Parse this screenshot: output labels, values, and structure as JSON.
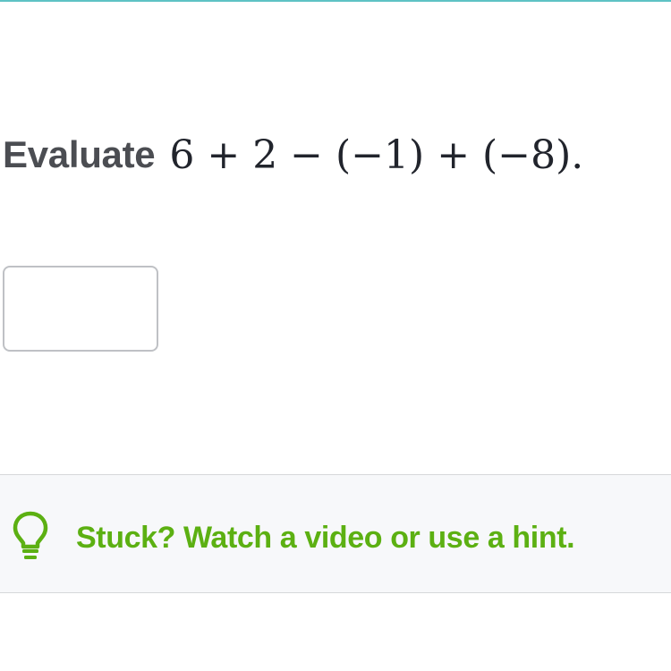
{
  "question": {
    "prompt_word": "Evaluate",
    "expression": "6 + 2 − (−1) + (−8)."
  },
  "answer": {
    "value": ""
  },
  "hint": {
    "icon": "lightbulb-icon",
    "text": "Stuck? Watch a video or use a hint."
  },
  "colors": {
    "accent_teal": "#5ec2c4",
    "hint_green": "#5cb012",
    "text_dark": "#21242c",
    "text_gray": "#4b4d52"
  }
}
